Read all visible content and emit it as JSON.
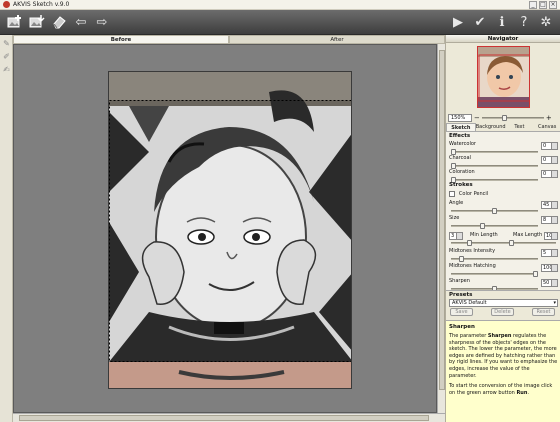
{
  "window": {
    "title": "AKVIS Sketch v.9.0",
    "buttons": [
      "_",
      "□",
      "×"
    ]
  },
  "toolbar": {
    "left_icons": [
      "open-image-icon",
      "save-image-icon",
      "eraser-icon",
      "undo-icon",
      "redo-icon"
    ],
    "right_icons": [
      "run-icon",
      "apply-icon",
      "info-icon",
      "help-icon",
      "settings-icon"
    ],
    "symbols": {
      "undo": "⇦",
      "redo": "⇨",
      "run": "▶",
      "apply": "✔",
      "info": "ℹ",
      "help": "?",
      "settings": "✲"
    }
  },
  "view_tabs": {
    "before": "Before",
    "after": "After"
  },
  "navigator": {
    "title": "Navigator",
    "zoom": "150%"
  },
  "settings_tabs": [
    "Sketch",
    "Background",
    "Text",
    "Canvas"
  ],
  "effects": {
    "title": "Effects",
    "params": [
      {
        "label": "Watercolor",
        "value": "0",
        "level": 0.0
      },
      {
        "label": "Charcoal",
        "value": "0",
        "level": 0.0
      },
      {
        "label": "Coloration",
        "value": "0",
        "level": 0.0
      }
    ]
  },
  "strokes": {
    "title": "Strokes",
    "color_pencil": "Color Pencil",
    "angle": {
      "label": "Angle",
      "value": "45",
      "level": 0.5
    },
    "size": {
      "label": "Size",
      "value": "8",
      "level": 0.35
    },
    "length": {
      "min_value": "3",
      "min_label": "Min Length",
      "max_label": "Max Length",
      "max_value": "10"
    },
    "midtones_intensity": {
      "label": "Midtones Intensity",
      "value": "5",
      "level": 0.1
    },
    "midtones_hatching": {
      "label": "Midtones Hatching",
      "value": "100",
      "level": 1.0
    },
    "sharpen": {
      "label": "Sharpen",
      "value": "50",
      "level": 0.5
    }
  },
  "presets": {
    "title": "Presets",
    "selected": "AKVIS Default",
    "save": "Save",
    "delete": "Delete",
    "reset": "Reset"
  },
  "help": {
    "title": "Sharpen",
    "p1_a": "The parameter ",
    "p1_bold": "Sharpen",
    "p1_b": " regulates the sharpness of the objects' edges on the sketch. The lower the parameter, the more edges are defined by hatching rather than by rigid lines. If you want to emphasize the edges, increase the value of the parameter.",
    "p2_a": "To start the conversion of the image click on the green arrow button ",
    "p2_bold": "Run",
    "p2_b": "."
  }
}
